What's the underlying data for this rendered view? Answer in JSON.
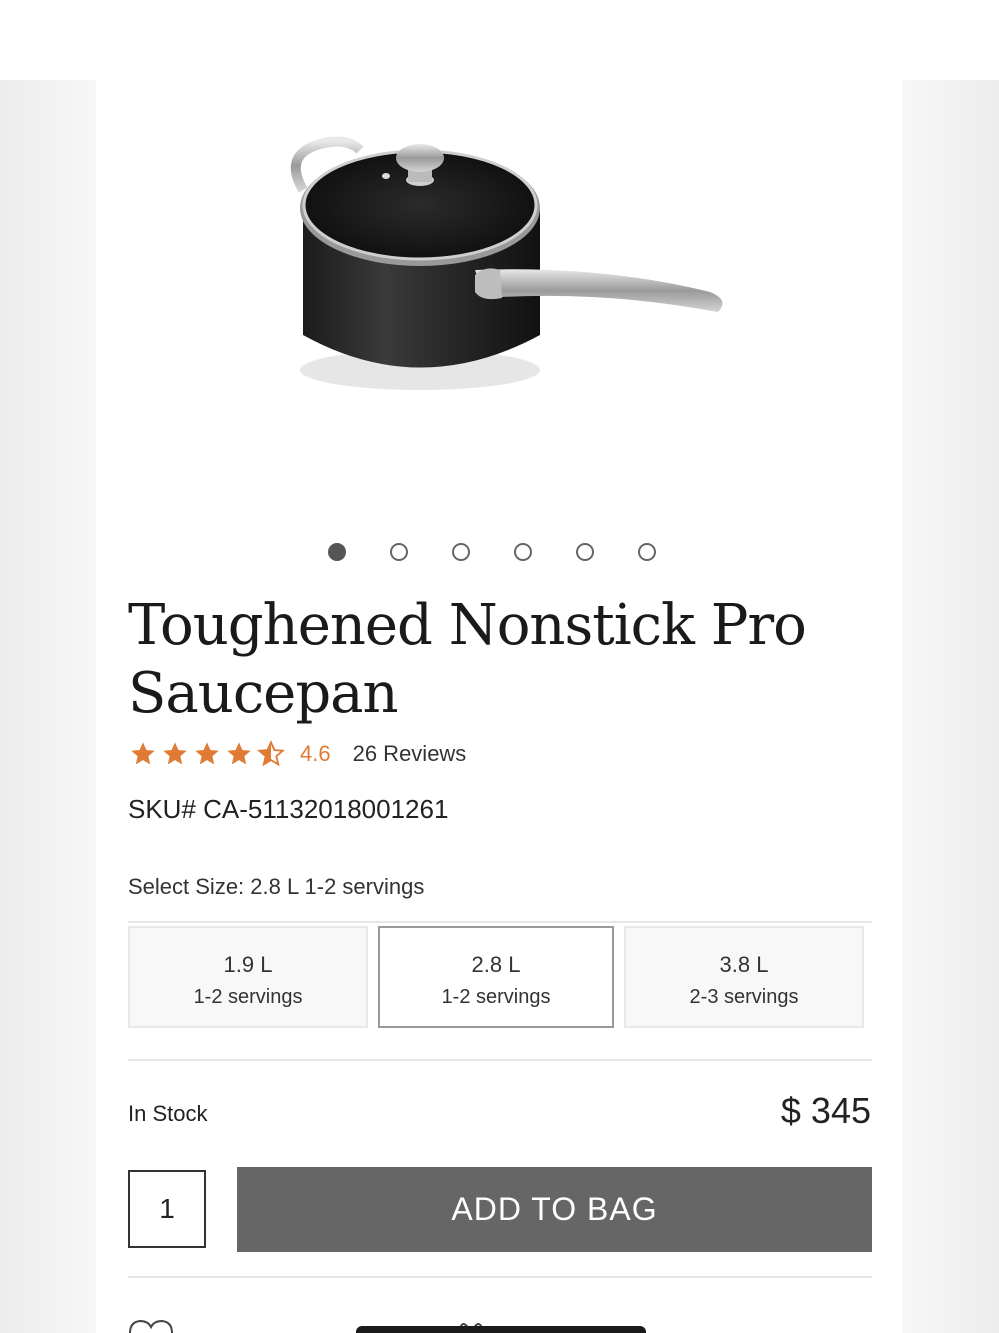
{
  "product": {
    "title_line1": "Toughened Nonstick Pro",
    "title_line2": "Saucepan",
    "rating_value": "4.6",
    "rating_stars": 4.5,
    "reviews": "26 Reviews",
    "sku": "SKU# CA-51132018001261"
  },
  "gallery": {
    "image_count": 6,
    "active_index": 0
  },
  "size": {
    "label": "Select Size: 2.8 L 1-2 servings",
    "options": [
      {
        "volume": "1.9 L",
        "servings": "1-2 servings",
        "selected": false
      },
      {
        "volume": "2.8 L",
        "servings": "1-2 servings",
        "selected": true
      },
      {
        "volume": "3.8 L",
        "servings": "2-3 servings",
        "selected": false
      }
    ]
  },
  "purchase": {
    "stock": "In Stock",
    "price": "$ 345",
    "quantity": "1",
    "add_label": "ADD TO BAG"
  },
  "icons": {
    "wishlist": "heart-icon",
    "gift": "gift-icon",
    "star": "star-icon"
  },
  "colors": {
    "star": "#e07b35",
    "button": "#666666"
  }
}
